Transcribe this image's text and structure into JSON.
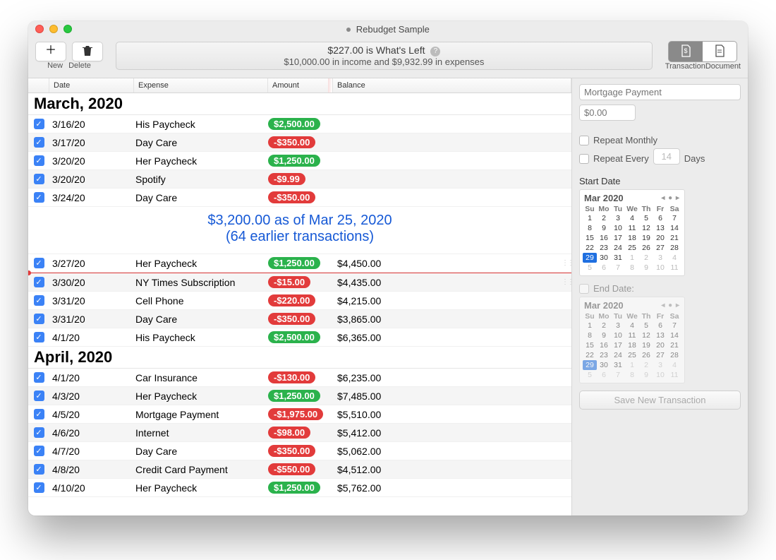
{
  "window": {
    "title": "Rebudget Sample"
  },
  "toolbar": {
    "new_label": "New",
    "delete_label": "Delete",
    "summary_line1": "$227.00 is What's Left",
    "summary_line2": "$10,000.00 in income and $9,932.99 in expenses",
    "seg_transaction": "Transaction",
    "seg_document": "Document"
  },
  "columns": {
    "date": "Date",
    "expense": "Expense",
    "amount": "Amount",
    "balance": "Balance"
  },
  "sections": [
    {
      "header": "March, 2020",
      "rows": [
        {
          "date": "3/16/20",
          "expense": "His Paycheck",
          "amount": "$2,500.00",
          "type": "green",
          "balance": ""
        },
        {
          "date": "3/17/20",
          "expense": "Day Care",
          "amount": "-$350.00",
          "type": "red",
          "balance": ""
        },
        {
          "date": "3/20/20",
          "expense": "Her Paycheck",
          "amount": "$1,250.00",
          "type": "green",
          "balance": ""
        },
        {
          "date": "3/20/20",
          "expense": "Spotify",
          "amount": "-$9.99",
          "type": "red",
          "balance": ""
        },
        {
          "date": "3/24/20",
          "expense": "Day Care",
          "amount": "-$350.00",
          "type": "red",
          "balance": ""
        }
      ],
      "summary": {
        "line1": "$3,200.00 as of Mar 25, 2020",
        "line2": "(64 earlier transactions)"
      },
      "rows2": [
        {
          "date": "3/27/20",
          "expense": "Her Paycheck",
          "amount": "$1,250.00",
          "type": "green",
          "balance": "$4,450.00",
          "grip": true
        }
      ],
      "redline": true,
      "rows3": [
        {
          "date": "3/30/20",
          "expense": "NY Times Subscription",
          "amount": "-$15.00",
          "type": "red",
          "balance": "$4,435.00",
          "grip": true
        },
        {
          "date": "3/31/20",
          "expense": "Cell Phone",
          "amount": "-$220.00",
          "type": "red",
          "balance": "$4,215.00"
        },
        {
          "date": "3/31/20",
          "expense": "Day Care",
          "amount": "-$350.00",
          "type": "red",
          "balance": "$3,865.00"
        },
        {
          "date": "4/1/20",
          "expense": "His Paycheck",
          "amount": "$2,500.00",
          "type": "green",
          "balance": "$6,365.00"
        }
      ]
    },
    {
      "header": "April, 2020",
      "rows": [
        {
          "date": "4/1/20",
          "expense": "Car Insurance",
          "amount": "-$130.00",
          "type": "red",
          "balance": "$6,235.00"
        },
        {
          "date": "4/3/20",
          "expense": "Her Paycheck",
          "amount": "$1,250.00",
          "type": "green",
          "balance": "$7,485.00"
        },
        {
          "date": "4/5/20",
          "expense": "Mortgage Payment",
          "amount": "-$1,975.00",
          "type": "red",
          "balance": "$5,510.00"
        },
        {
          "date": "4/6/20",
          "expense": "Internet",
          "amount": "-$98.00",
          "type": "red",
          "balance": "$5,412.00"
        },
        {
          "date": "4/7/20",
          "expense": "Day Care",
          "amount": "-$350.00",
          "type": "red",
          "balance": "$5,062.00"
        },
        {
          "date": "4/8/20",
          "expense": "Credit Card Payment",
          "amount": "-$550.00",
          "type": "red",
          "balance": "$4,512.00"
        },
        {
          "date": "4/10/20",
          "expense": "Her Paycheck",
          "amount": "$1,250.00",
          "type": "green",
          "balance": "$5,762.00"
        }
      ]
    }
  ],
  "sidebar": {
    "name_placeholder": "Mortgage Payment",
    "amount_placeholder": "$0.00",
    "repeat_monthly": "Repeat Monthly",
    "repeat_every": "Repeat Every",
    "repeat_every_value": "14",
    "days_label": "Days",
    "start_date_label": "Start Date",
    "end_date_label": "End Date:",
    "cal_month": "Mar 2020",
    "cal_dow": [
      "Su",
      "Mo",
      "Tu",
      "We",
      "Th",
      "Fr",
      "Sa"
    ],
    "cal_days": [
      {
        "d": "1"
      },
      {
        "d": "2"
      },
      {
        "d": "3"
      },
      {
        "d": "4"
      },
      {
        "d": "5"
      },
      {
        "d": "6"
      },
      {
        "d": "7"
      },
      {
        "d": "8"
      },
      {
        "d": "9"
      },
      {
        "d": "10"
      },
      {
        "d": "11"
      },
      {
        "d": "12"
      },
      {
        "d": "13"
      },
      {
        "d": "14"
      },
      {
        "d": "15"
      },
      {
        "d": "16"
      },
      {
        "d": "17"
      },
      {
        "d": "18"
      },
      {
        "d": "19"
      },
      {
        "d": "20"
      },
      {
        "d": "21"
      },
      {
        "d": "22"
      },
      {
        "d": "23"
      },
      {
        "d": "24"
      },
      {
        "d": "25"
      },
      {
        "d": "26"
      },
      {
        "d": "27"
      },
      {
        "d": "28"
      },
      {
        "d": "29",
        "sel": true
      },
      {
        "d": "30"
      },
      {
        "d": "31"
      },
      {
        "d": "1",
        "out": true
      },
      {
        "d": "2",
        "out": true
      },
      {
        "d": "3",
        "out": true
      },
      {
        "d": "4",
        "out": true
      },
      {
        "d": "5",
        "out": true
      },
      {
        "d": "6",
        "out": true
      },
      {
        "d": "7",
        "out": true
      },
      {
        "d": "8",
        "out": true
      },
      {
        "d": "9",
        "out": true
      },
      {
        "d": "10",
        "out": true
      },
      {
        "d": "11",
        "out": true
      }
    ],
    "save_label": "Save New Transaction"
  }
}
